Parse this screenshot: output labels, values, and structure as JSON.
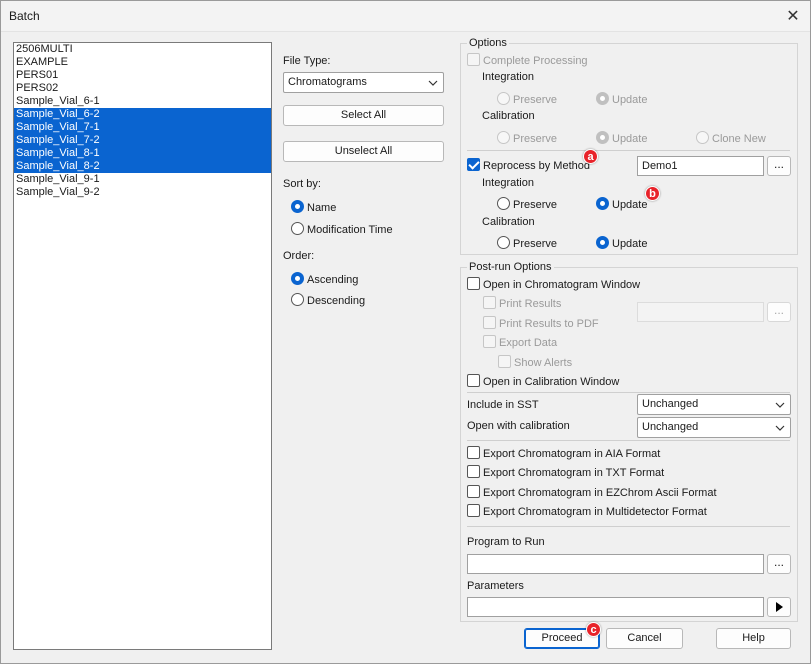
{
  "window": {
    "title": "Batch",
    "close_glyph": "✕"
  },
  "list_items": [
    "2506MULTI",
    "EXAMPLE",
    "PERS01",
    "PERS02",
    "Sample_Vial_6-1",
    "Sample_Vial_6-2",
    "Sample_Vial_7-1",
    "Sample_Vial_7-2",
    "Sample_Vial_8-1",
    "Sample_Vial_8-2",
    "Sample_Vial_9-1",
    "Sample_Vial_9-2"
  ],
  "file_type": {
    "label": "File Type:",
    "value": "Chromatograms"
  },
  "buttons": {
    "select_all": "Select All",
    "unselect_all": "Unselect All",
    "proceed": "Proceed",
    "cancel": "Cancel",
    "help": "Help",
    "browse": "..."
  },
  "sort_by": {
    "label": "Sort by:",
    "name": "Name",
    "modification_time": "Modification Time"
  },
  "order": {
    "label": "Order:",
    "ascending": "Ascending",
    "descending": "Descending"
  },
  "options": {
    "title": "Options",
    "complete_processing": "Complete Processing",
    "integration": "Integration",
    "calibration": "Calibration",
    "preserve": "Preserve",
    "update": "Update",
    "clone_new": "Clone New",
    "reprocess_by_method": "Reprocess by Method",
    "method_value": "Demo1"
  },
  "post_run": {
    "title": "Post-run Options",
    "open_chrom_window": "Open in Chromatogram Window",
    "print_results": "Print Results",
    "print_results_pdf": "Print Results to PDF",
    "export_data": "Export Data",
    "show_alerts": "Show Alerts",
    "open_calib_window": "Open in Calibration Window",
    "include_in_sst": "Include in SST",
    "include_in_sst_value": "Unchanged",
    "open_with_calibration": "Open with calibration",
    "open_with_calibration_value": "Unchanged",
    "export_aia": "Export Chromatogram in AIA Format",
    "export_txt": "Export Chromatogram in TXT Format",
    "export_ezchrom": "Export Chromatogram in EZChrom Ascii Format",
    "export_multidetector": "Export Chromatogram in Multidetector Format",
    "program_to_run": "Program to Run",
    "parameters": "Parameters"
  },
  "badges": {
    "a": "a",
    "b": "b",
    "c": "c"
  },
  "colors": {
    "accent": "#0a64d0",
    "selection": "#0a64d0",
    "badge": "#e8232a"
  }
}
